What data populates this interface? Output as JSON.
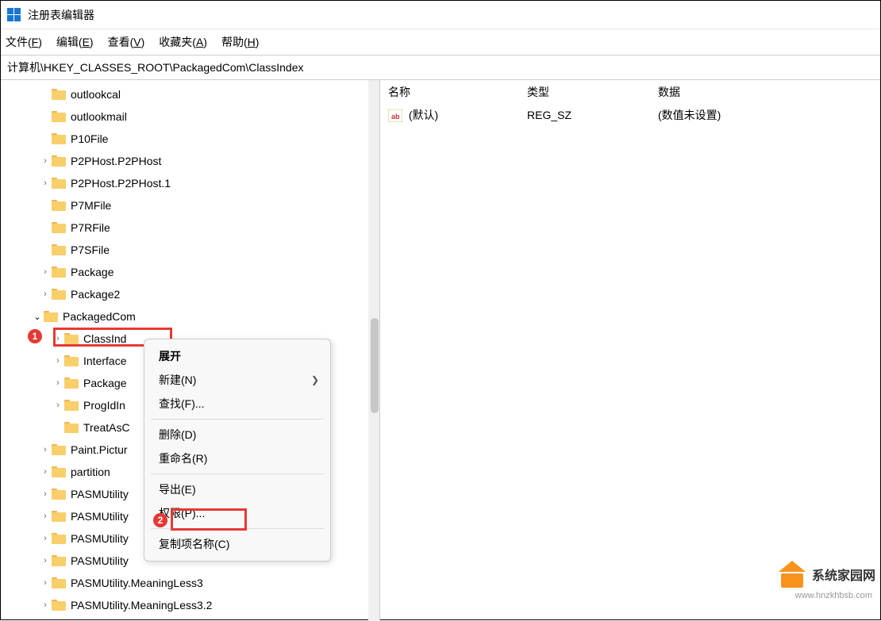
{
  "title": "注册表编辑器",
  "menu": {
    "file": "文件(F)",
    "edit": "编辑(E)",
    "view": "查看(V)",
    "favorites": "收藏夹(A)",
    "help": "帮助(H)"
  },
  "address": "计算机\\HKEY_CLASSES_ROOT\\PackagedCom\\ClassIndex",
  "tree": {
    "items": [
      {
        "label": "outlookcal",
        "indent": 1,
        "caret": ""
      },
      {
        "label": "outlookmail",
        "indent": 1,
        "caret": ""
      },
      {
        "label": "P10File",
        "indent": 1,
        "caret": ""
      },
      {
        "label": "P2PHost.P2PHost",
        "indent": 1,
        "caret": ">"
      },
      {
        "label": "P2PHost.P2PHost.1",
        "indent": 1,
        "caret": ">"
      },
      {
        "label": "P7MFile",
        "indent": 1,
        "caret": ""
      },
      {
        "label": "P7RFile",
        "indent": 1,
        "caret": ""
      },
      {
        "label": "P7SFile",
        "indent": 1,
        "caret": ""
      },
      {
        "label": "Package",
        "indent": 1,
        "caret": ">"
      },
      {
        "label": "Package2",
        "indent": 1,
        "caret": ">"
      },
      {
        "label": "PackagedCom",
        "indent": 2,
        "caret": "v"
      },
      {
        "label": "ClassInd",
        "indent": 3,
        "caret": ">"
      },
      {
        "label": "Interface",
        "indent": 3,
        "caret": ">"
      },
      {
        "label": "Package",
        "indent": 3,
        "caret": ">"
      },
      {
        "label": "ProgIdIn",
        "indent": 3,
        "caret": ">"
      },
      {
        "label": "TreatAsC",
        "indent": 3,
        "caret": ""
      },
      {
        "label": "Paint.Pictur",
        "indent": 1,
        "caret": ">"
      },
      {
        "label": "partition",
        "indent": 1,
        "caret": ">"
      },
      {
        "label": "PASMUtility",
        "indent": 1,
        "caret": ">"
      },
      {
        "label": "PASMUtility",
        "indent": 1,
        "caret": ">"
      },
      {
        "label": "PASMUtility",
        "indent": 1,
        "caret": ">"
      },
      {
        "label": "PASMUtility",
        "indent": 1,
        "caret": ">"
      },
      {
        "label": "PASMUtility.MeaningLess3",
        "indent": 1,
        "caret": ">"
      },
      {
        "label": "PASMUtility.MeaningLess3.2",
        "indent": 1,
        "caret": ">"
      }
    ]
  },
  "list": {
    "headers": {
      "name": "名称",
      "type": "类型",
      "data": "数据"
    },
    "rows": [
      {
        "name": "(默认)",
        "type": "REG_SZ",
        "data": "(数值未设置)"
      }
    ]
  },
  "context_menu": {
    "expand": "展开",
    "new": "新建(N)",
    "find": "查找(F)...",
    "delete": "删除(D)",
    "rename": "重命名(R)",
    "export": "导出(E)",
    "permissions": "权限(P)...",
    "copy_key_name": "复制项名称(C)"
  },
  "markers": {
    "one": "1",
    "two": "2"
  },
  "watermark": {
    "text": "系统家园网",
    "url": "www.hnzkhbsb.com"
  }
}
